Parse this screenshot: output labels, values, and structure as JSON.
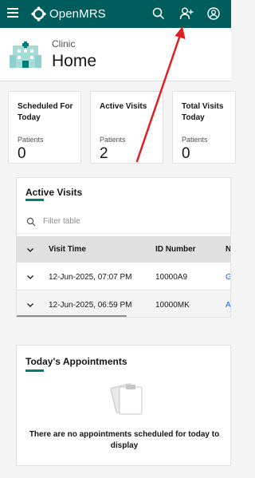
{
  "topbar": {
    "brand": "OpenMRS",
    "icons": [
      "menu-icon",
      "search-icon",
      "add-patient-icon",
      "user-avatar-icon"
    ]
  },
  "header": {
    "location": "Clinic",
    "title": "Home"
  },
  "metrics": [
    {
      "title": "Scheduled For Today",
      "label": "Patients",
      "value": "0"
    },
    {
      "title": "Active Visits",
      "label": "Patients",
      "value": "2"
    },
    {
      "title": "Total Visits Today",
      "label": "Patients",
      "value": "0"
    }
  ],
  "active_visits": {
    "title": "Active Visits",
    "filter_placeholder": "Filter table",
    "columns": [
      "Visit Time",
      "ID Number",
      "N"
    ],
    "rows": [
      {
        "visit_time": "12-Jun-2025, 07:07 PM",
        "id_number": "10000A9",
        "name": "G"
      },
      {
        "visit_time": "12-Jun-2025, 06:59 PM",
        "id_number": "10000MK",
        "name": "A"
      }
    ]
  },
  "appointments": {
    "title": "Today's Appointments",
    "empty_message": "There are no appointments scheduled for today to display"
  },
  "colors": {
    "topbar": "#005d5d",
    "accent": "#007d79",
    "link": "#0f62fe",
    "annotation_arrow": "#e02020"
  }
}
